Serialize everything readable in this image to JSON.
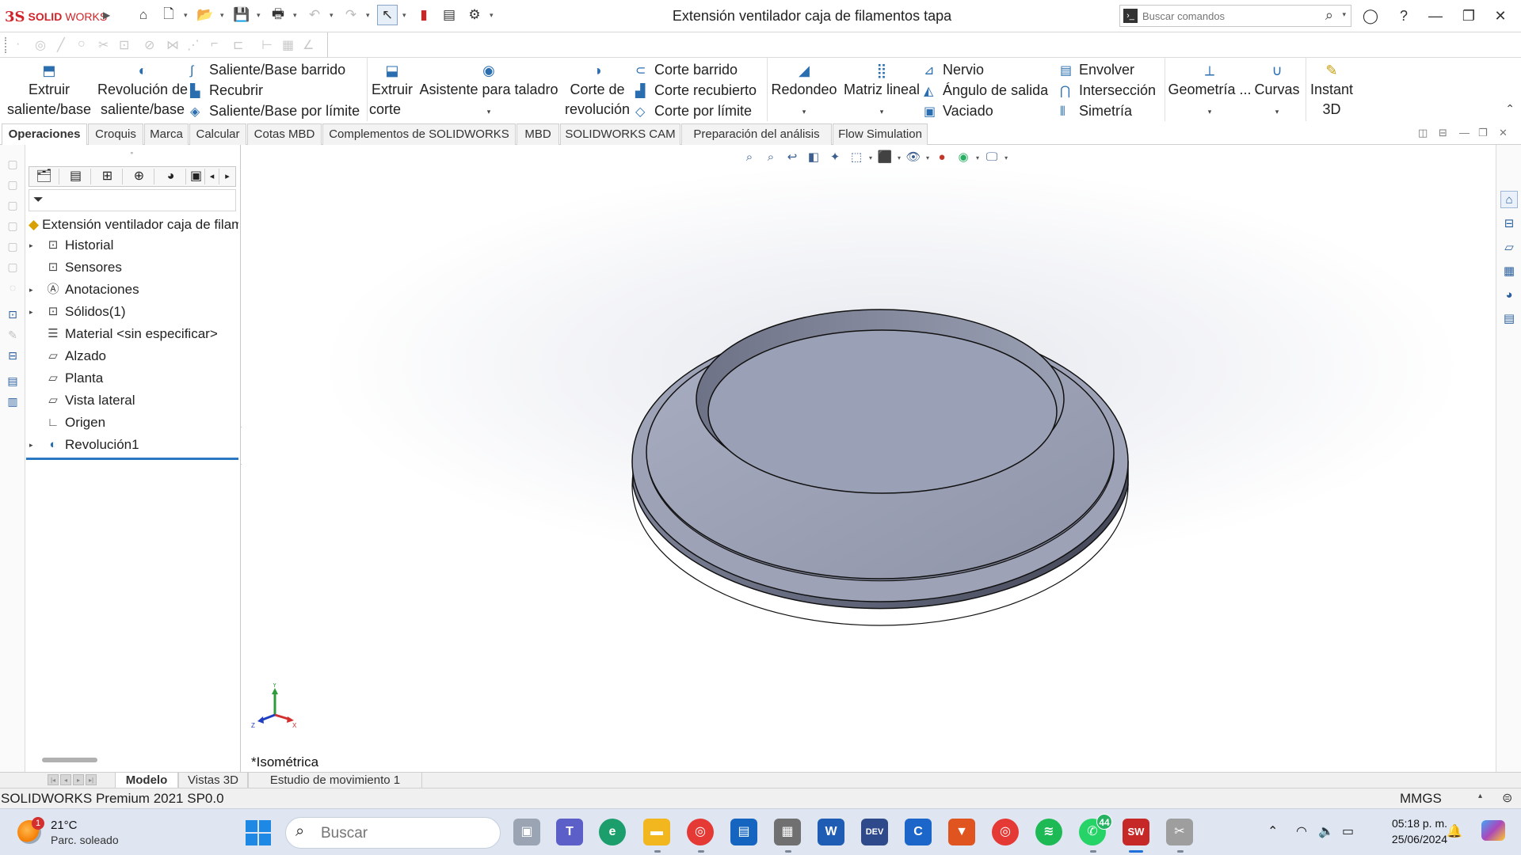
{
  "app": {
    "logo_ds": "3S",
    "logo_solid": "SOLID",
    "logo_works": "WORKS",
    "document_title": "Extensión ventilador caja de filamentos tapa"
  },
  "search": {
    "placeholder": "Buscar comandos"
  },
  "ribbon": {
    "extrude_boss": [
      "Extruir",
      "saliente/base"
    ],
    "revolve_boss": [
      "Revolución de",
      "saliente/base"
    ],
    "swept_boss": "Saliente/Base barrido",
    "loft": "Recubrir",
    "boundary_boss": "Saliente/Base por límite",
    "extrude_cut": [
      "Extruir",
      "corte"
    ],
    "hole_wizard": "Asistente para taladro",
    "revolve_cut": [
      "Corte de",
      "revolución"
    ],
    "swept_cut": "Corte barrido",
    "lofted_cut": "Corte recubierto",
    "boundary_cut": "Corte por límite",
    "fillet": "Redondeo",
    "linear_pattern": "Matriz lineal",
    "rib": "Nervio",
    "draft": "Ángulo de salida",
    "shell": "Vaciado",
    "wrap": "Envolver",
    "intersect": "Intersección",
    "mirror": "Simetría",
    "ref_geometry": "Geometría ...",
    "curves": "Curvas",
    "instant3d": [
      "Instant",
      "3D"
    ]
  },
  "tabs": [
    "Operaciones",
    "Croquis",
    "Marca",
    "Calcular",
    "Cotas MBD",
    "Complementos de SOLIDWORKS",
    "MBD",
    "SOLIDWORKS CAM",
    "Preparación del análisis",
    "Flow Simulation"
  ],
  "feature_tree": {
    "root": "Extensión ventilador caja de filamentos tapa",
    "items": [
      {
        "label": "Historial",
        "icon": "history-icon",
        "expand": true
      },
      {
        "label": "Sensores",
        "icon": "sensor-icon",
        "expand": false
      },
      {
        "label": "Anotaciones",
        "icon": "annotation-icon",
        "expand": true
      },
      {
        "label": "Sólidos(1)",
        "icon": "solid-bodies-icon",
        "expand": true
      },
      {
        "label": "Material <sin especificar>",
        "icon": "material-icon",
        "expand": false
      },
      {
        "label": "Alzado",
        "icon": "plane-icon",
        "expand": false
      },
      {
        "label": "Planta",
        "icon": "plane-icon",
        "expand": false
      },
      {
        "label": "Vista lateral",
        "icon": "plane-icon",
        "expand": false
      },
      {
        "label": "Origen",
        "icon": "origin-icon",
        "expand": false
      },
      {
        "label": "Revolución1",
        "icon": "revolve-icon",
        "expand": true
      }
    ]
  },
  "viewport": {
    "orientation_label": "*Isométrica",
    "triad": {
      "x": "X",
      "y": "Y",
      "z": "Z"
    }
  },
  "bottom_tabs": [
    "Modelo",
    "Vistas 3D",
    "Estudio de movimiento 1"
  ],
  "status": {
    "product": "SOLIDWORKS Premium 2021 SP0.0",
    "units": "MMGS"
  },
  "taskbar": {
    "weather_temp": "21°C",
    "weather_cond": "Parc. soleado",
    "weather_badge": "1",
    "search_placeholder": "Buscar",
    "whatsapp_badge": "44",
    "time": "05:18 p. m.",
    "date": "25/06/2024"
  },
  "colors": {
    "accent": "#2b78c2",
    "brand_red": "#d0242a",
    "part_gray": "#9ea3b8"
  }
}
